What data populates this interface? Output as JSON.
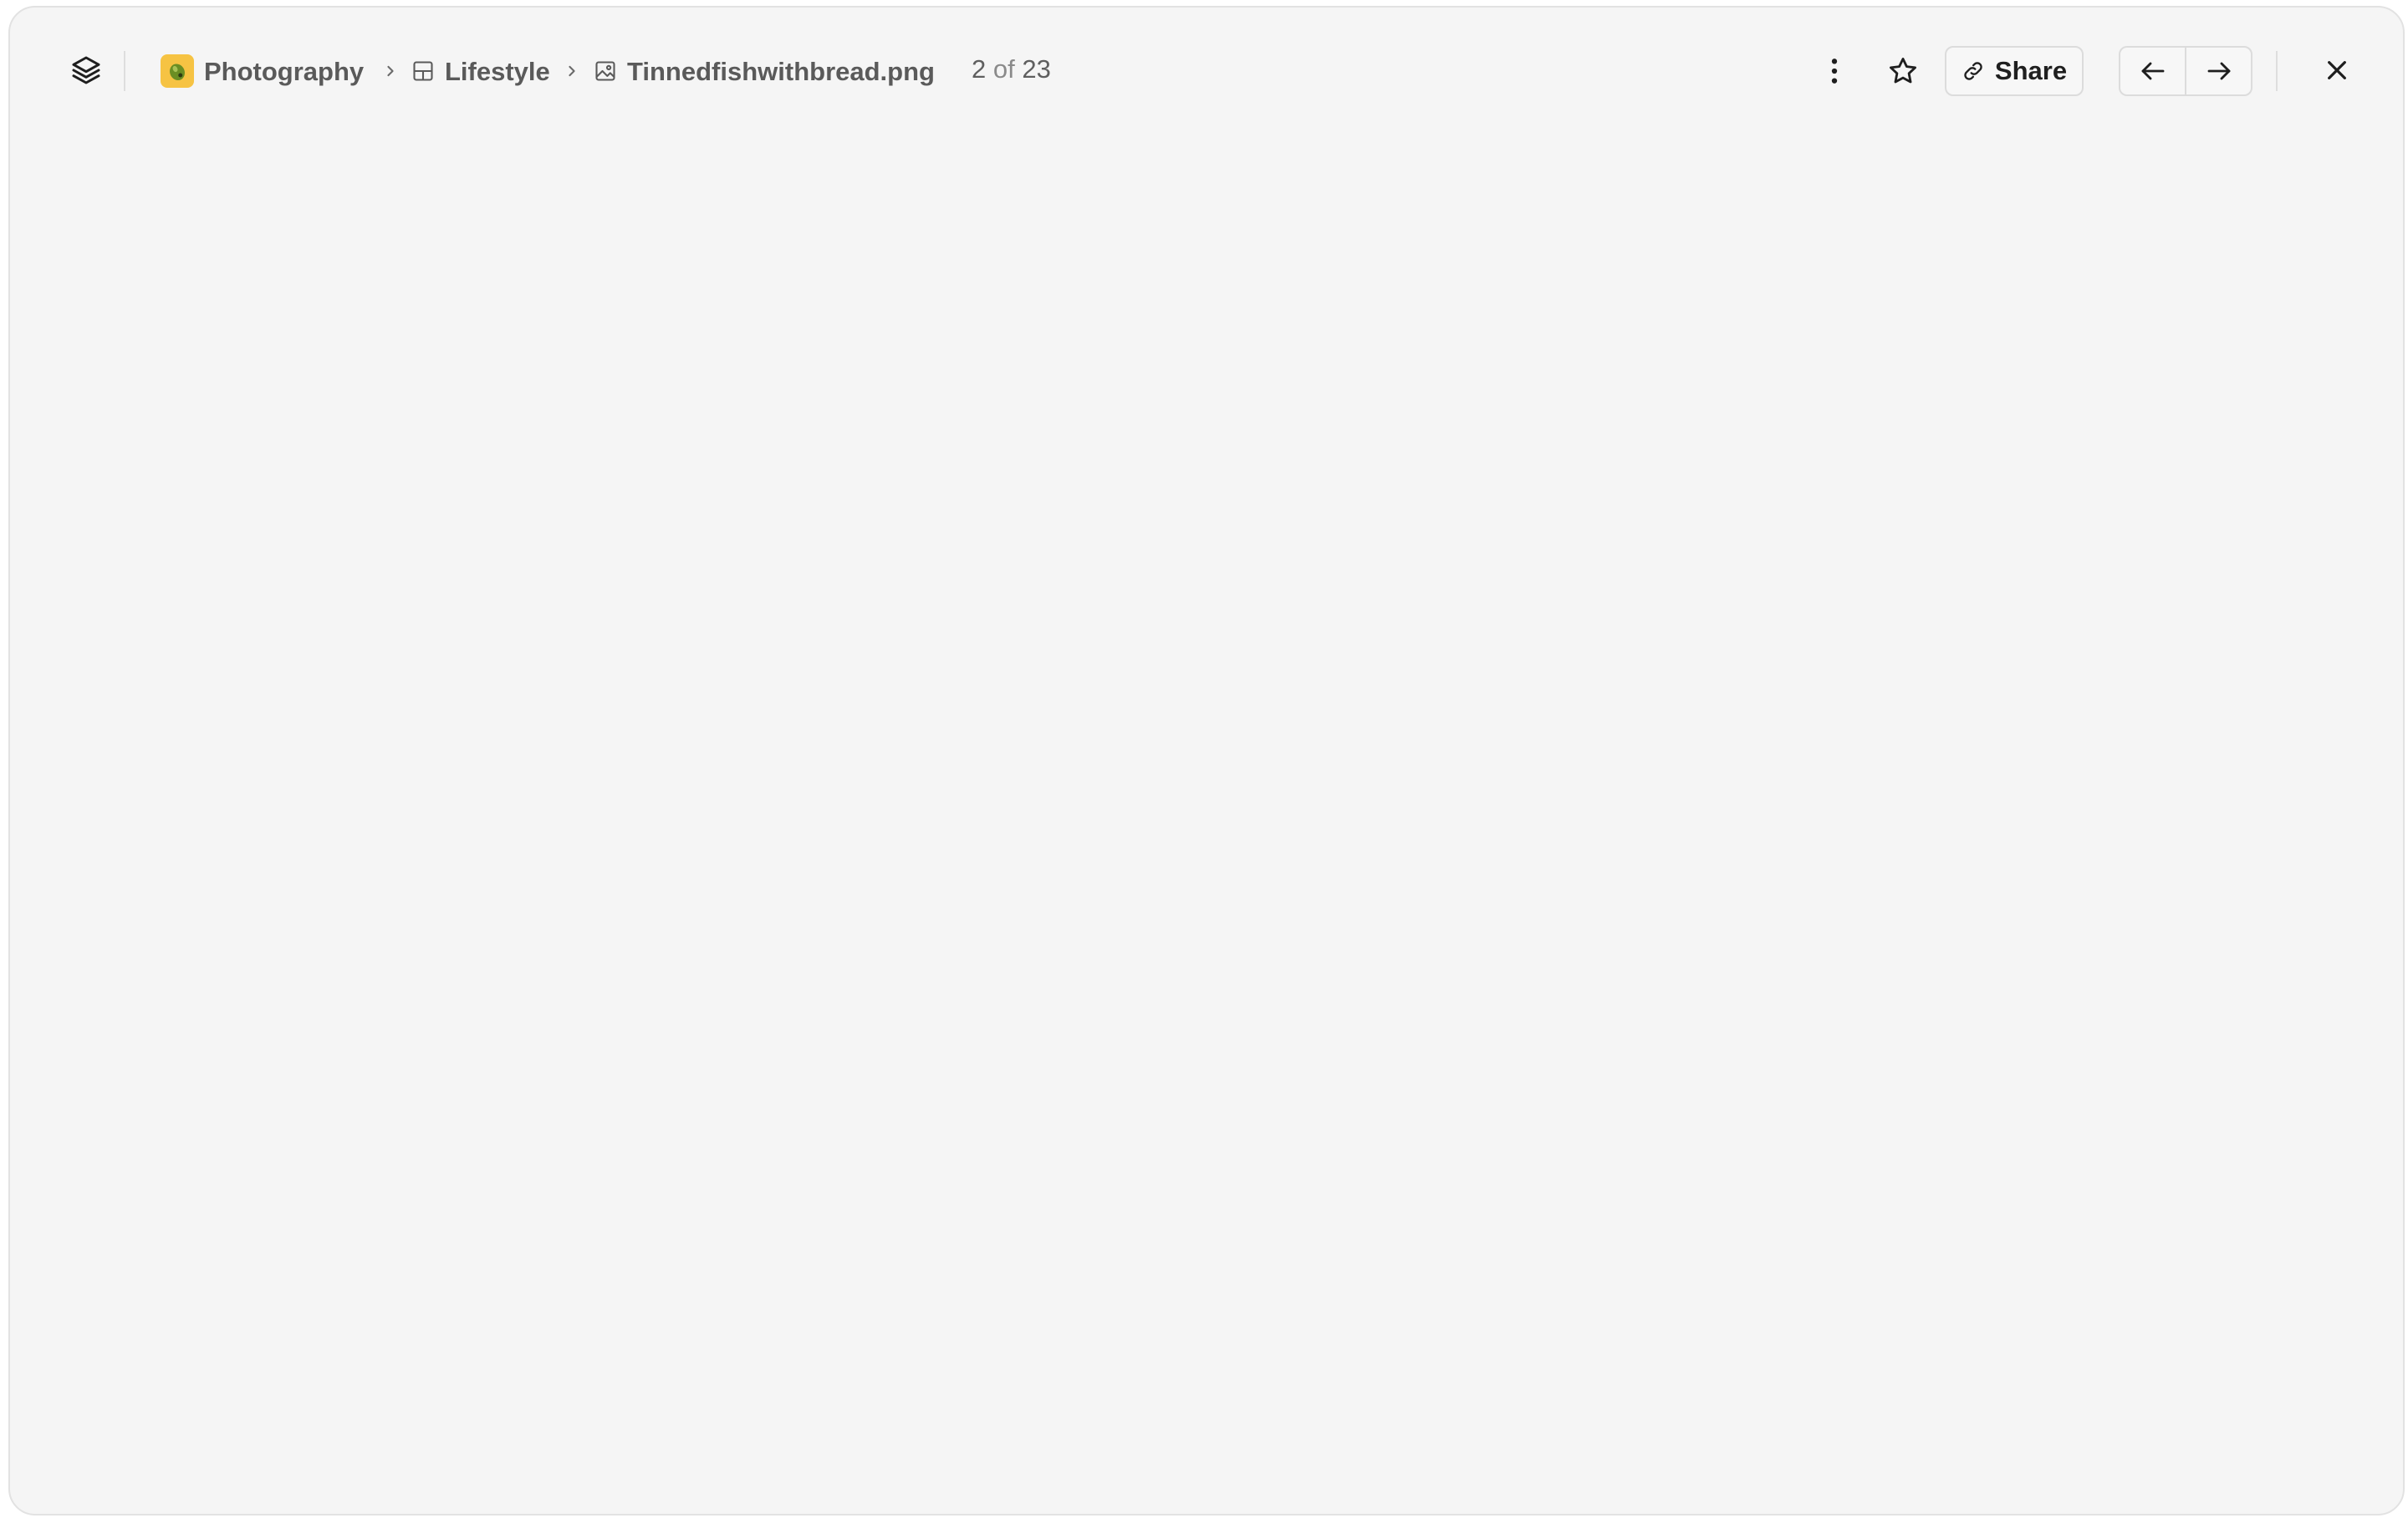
{
  "breadcrumb": {
    "workspace": {
      "label": "Photography",
      "icon": "olive-emoji-icon"
    },
    "folder": {
      "label": "Lifestyle",
      "icon": "board-layout-icon"
    },
    "file": {
      "label": "Tinnedfishwithbread.png",
      "icon": "image-file-icon"
    }
  },
  "counter": {
    "current": "2",
    "of_text": "of",
    "total": "23"
  },
  "actions": {
    "more_icon": "more-vertical-icon",
    "favorite_icon": "star-icon",
    "share_label": "Share",
    "share_icon": "link-icon",
    "prev_icon": "arrow-left-icon",
    "next_icon": "arrow-right-icon",
    "close_icon": "close-icon"
  },
  "colors": {
    "background": "#f5f5f5",
    "border": "#dcdcdc",
    "text": "#5a5a5a",
    "workspace_icon_bg": "#f6c343"
  }
}
